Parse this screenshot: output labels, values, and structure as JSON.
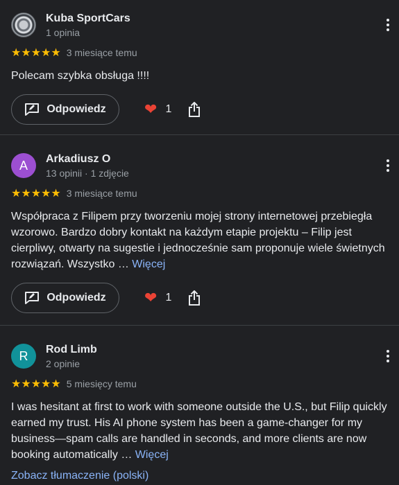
{
  "colors": {
    "star": "#fbbc04",
    "link": "#8ab4f8",
    "heart": "#ea4335",
    "background": "#202124"
  },
  "reviews": [
    {
      "author": "Kuba SportCars",
      "meta": "1 opinia",
      "stars": "★★★★★",
      "rating": 5,
      "time": "3 miesiące temu",
      "text": "Polecam szybka obsługa !!!!",
      "reply_label": "Odpowiedz",
      "likes": "1"
    },
    {
      "author": "Arkadiusz O",
      "avatar_letter": "A",
      "avatar_color": "#9c4fd1",
      "meta": "13 opinii · 1 zdjęcie",
      "stars": "★★★★★",
      "rating": 5,
      "time": "3 miesiące temu",
      "text": "Współpraca z Filipem przy tworzeniu mojej strony internetowej przebiegła wzorowo. Bardzo dobry kontakt na każdym etapie projektu – Filip jest cierpliwy, otwarty na sugestie i jednocześnie sam proponuje wiele świetnych rozwiązań. Wszystko …",
      "more_label": "Więcej",
      "reply_label": "Odpowiedz",
      "likes": "1"
    },
    {
      "author": "Rod Limb",
      "avatar_letter": "R",
      "avatar_color": "#11929a",
      "meta": "2 opinie",
      "stars": "★★★★★",
      "rating": 5,
      "time": "5 miesięcy temu",
      "text": "I was hesitant at first to work with someone outside the U.S., but Filip quickly earned my trust. His AI phone system has been a game-changer for my business—spam calls are handled in seconds, and more clients are now booking automatically …",
      "more_label": "Więcej",
      "translate_label": "Zobacz tłumaczenie (polski)"
    }
  ]
}
